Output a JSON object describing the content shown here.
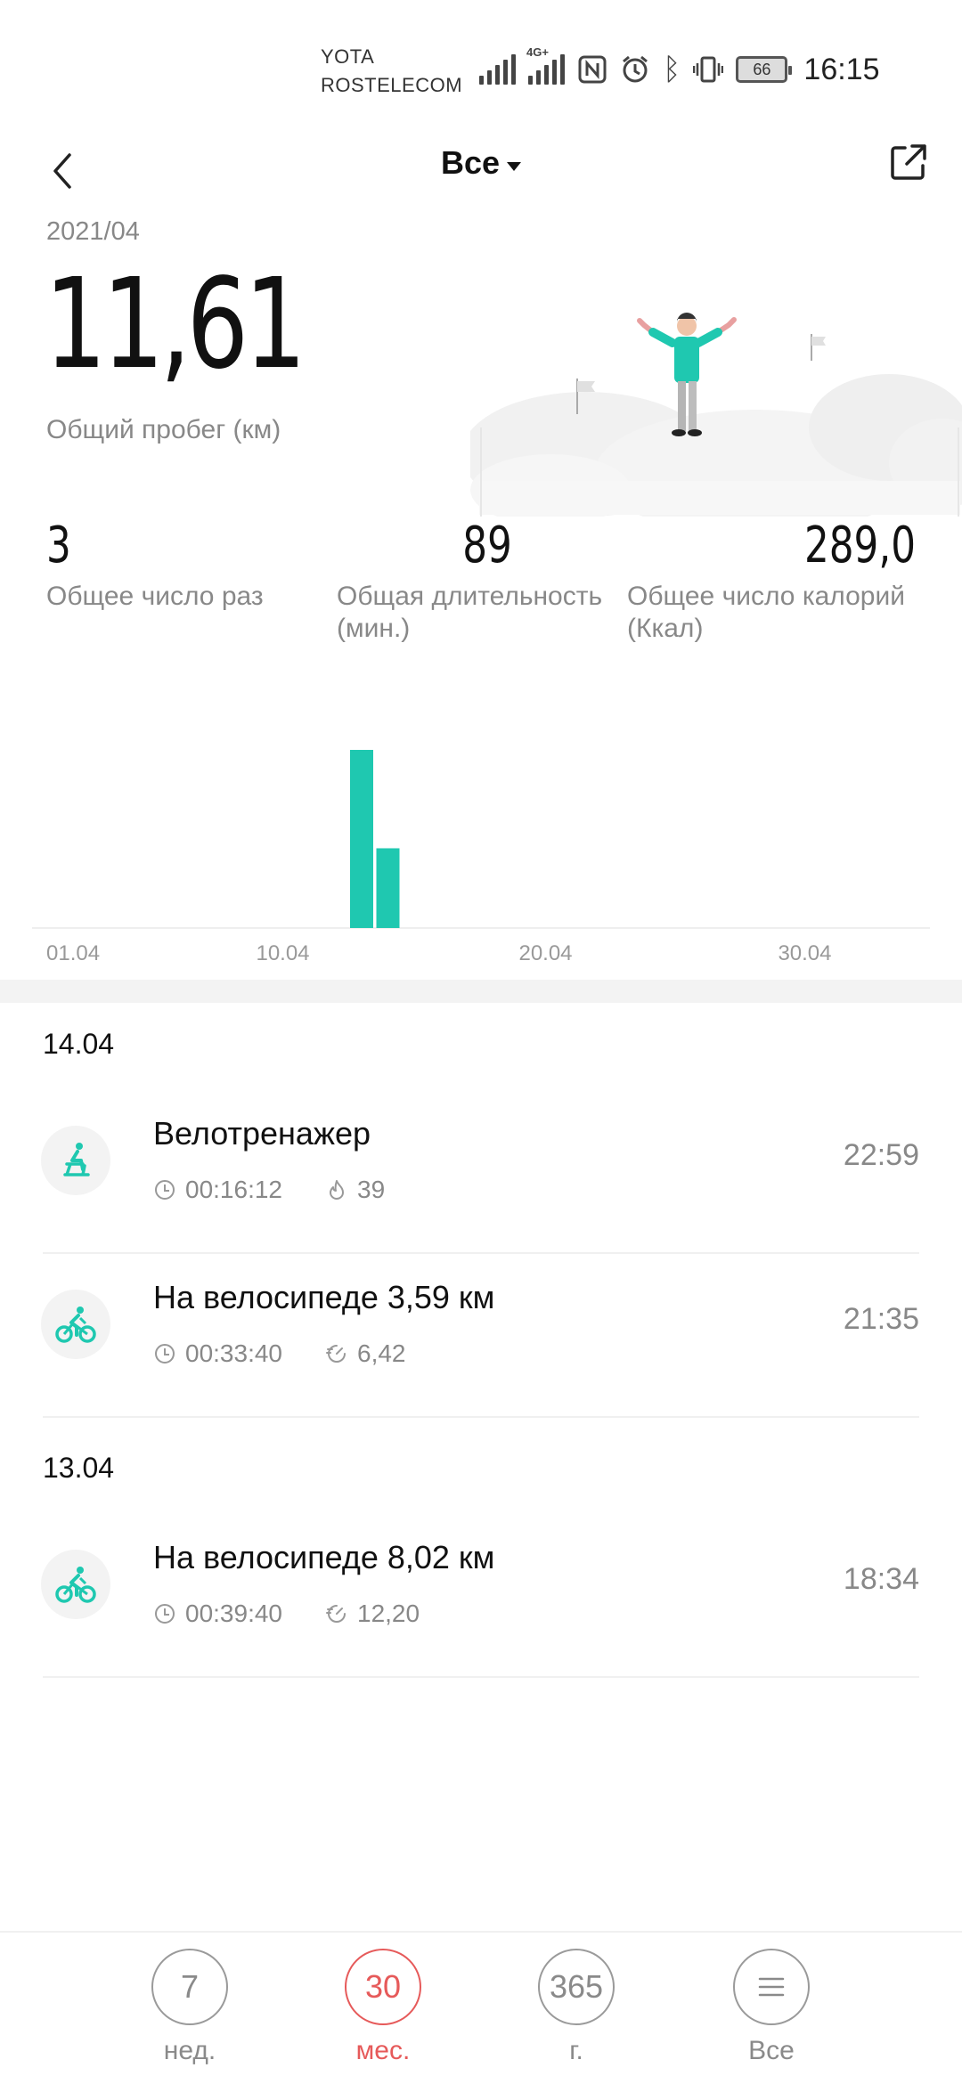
{
  "status_bar": {
    "carrier_line1": "YOTA",
    "carrier_line2": "ROSTELECOM",
    "network_type": "4G+",
    "battery_level": "66",
    "time": "16:15"
  },
  "header": {
    "title": "Все",
    "back_icon": "back-arrow-icon",
    "share_icon": "share-icon"
  },
  "summary": {
    "period": "2021/04",
    "total_distance": "11,61",
    "total_distance_label": "Общий пробег (км)",
    "stats": [
      {
        "value": "3",
        "label": "Общее число раз"
      },
      {
        "value": "89",
        "label": "Общая длительность (мин.)"
      },
      {
        "value": "289,0",
        "label": "Общее число калорий (Ккал)"
      }
    ]
  },
  "chart_data": {
    "type": "bar",
    "x": [
      "13.04",
      "14.04"
    ],
    "values": [
      8.02,
      3.59
    ],
    "xticks": [
      "01.04",
      "10.04",
      "20.04",
      "30.04"
    ],
    "xlim": [
      "01.04",
      "30.04"
    ],
    "color": "#1fc8b0",
    "grid": false
  },
  "activities": {
    "groups": [
      {
        "date": "14.04",
        "items": [
          {
            "name": "Велотренажер",
            "duration": "00:16:12",
            "metric": "39",
            "metric_icon": "flame-icon",
            "icon": "exercise-bike-icon",
            "time": "22:59"
          },
          {
            "name": "На велосипеде 3,59 км",
            "duration": "00:33:40",
            "metric": "6,42",
            "metric_icon": "speed-icon",
            "icon": "cycling-icon",
            "time": "21:35"
          }
        ]
      },
      {
        "date": "13.04",
        "items": [
          {
            "name": "На велосипеде 8,02 км",
            "duration": "00:39:40",
            "metric": "12,20",
            "metric_icon": "speed-icon",
            "icon": "cycling-icon",
            "time": "18:34"
          }
        ]
      }
    ]
  },
  "tabs": [
    {
      "number": "7",
      "label": "нед.",
      "active": false
    },
    {
      "number": "30",
      "label": "мес.",
      "active": true
    },
    {
      "number": "365",
      "label": "г.",
      "active": false
    },
    {
      "number": "",
      "label": "Все",
      "active": false,
      "icon": "menu-icon"
    }
  ],
  "colors": {
    "accent": "#1fc8b0",
    "active_tab": "#e65a5a",
    "secondary_text": "#888888"
  }
}
